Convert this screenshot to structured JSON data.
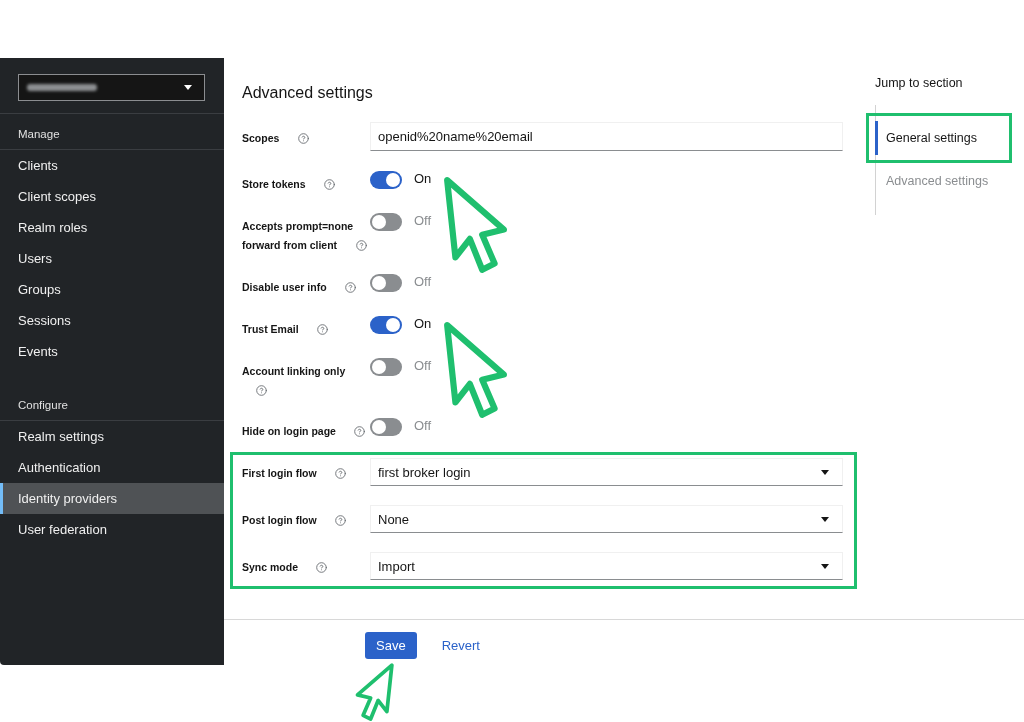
{
  "sidebar": {
    "sections": [
      {
        "heading": "Manage",
        "items": [
          {
            "label": "Clients",
            "selected": false
          },
          {
            "label": "Client scopes",
            "selected": false
          },
          {
            "label": "Realm roles",
            "selected": false
          },
          {
            "label": "Users",
            "selected": false
          },
          {
            "label": "Groups",
            "selected": false
          },
          {
            "label": "Sessions",
            "selected": false
          },
          {
            "label": "Events",
            "selected": false
          }
        ]
      },
      {
        "heading": "Configure",
        "items": [
          {
            "label": "Realm settings",
            "selected": false
          },
          {
            "label": "Authentication",
            "selected": false
          },
          {
            "label": "Identity providers",
            "selected": true
          },
          {
            "label": "User federation",
            "selected": false
          }
        ]
      }
    ]
  },
  "main": {
    "title": "Advanced settings",
    "fields": [
      {
        "kind": "text",
        "label": "Scopes",
        "value": "openid%20name%20email"
      },
      {
        "kind": "toggle",
        "label": "Store tokens",
        "on": true,
        "state_text": "On",
        "pointer_annotation": true
      },
      {
        "kind": "toggle",
        "label": "Accepts prompt=none forward from client",
        "on": false,
        "state_text": "Off"
      },
      {
        "kind": "toggle",
        "label": "Disable user info",
        "on": false,
        "state_text": "Off"
      },
      {
        "kind": "toggle",
        "label": "Trust Email",
        "on": true,
        "state_text": "On",
        "pointer_annotation": true
      },
      {
        "kind": "toggle",
        "label": "Account linking only",
        "on": false,
        "state_text": "Off"
      },
      {
        "kind": "toggle",
        "label": "Hide on login page",
        "on": false,
        "state_text": "Off"
      }
    ],
    "flow_group": {
      "highlighted": true,
      "fields": [
        {
          "kind": "select",
          "label": "First login flow",
          "value": "first broker login"
        },
        {
          "kind": "select",
          "label": "Post login flow",
          "value": "None"
        },
        {
          "kind": "select",
          "label": "Sync mode",
          "value": "Import"
        }
      ]
    }
  },
  "jump_to_section": {
    "heading": "Jump to section",
    "links": [
      {
        "label": "General settings",
        "selected": true,
        "highlighted": true
      },
      {
        "label": "Advanced settings",
        "selected": false
      }
    ]
  },
  "footer": {
    "buttons": [
      {
        "kind": "primary",
        "label": "Save",
        "pointer_annotation": true
      },
      {
        "kind": "link",
        "label": "Revert"
      }
    ]
  }
}
